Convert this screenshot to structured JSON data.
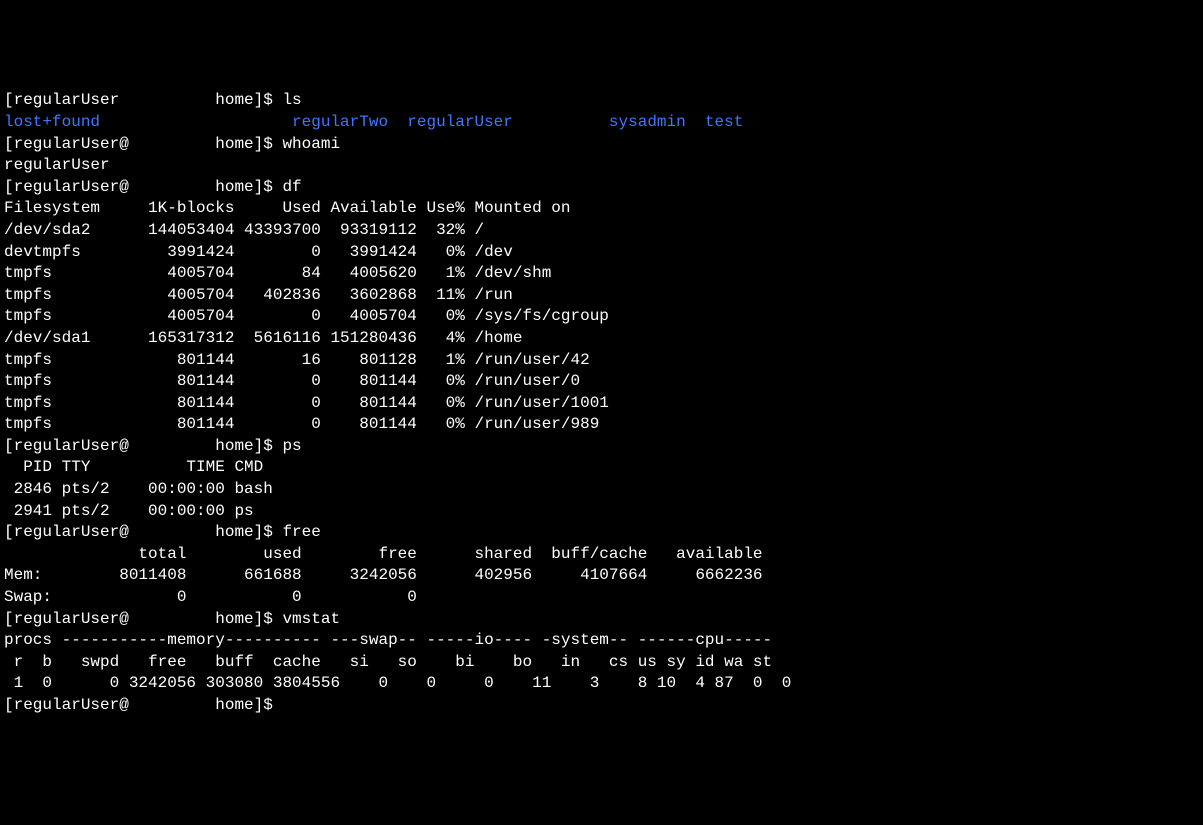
{
  "lines": [
    {
      "type": "prompt",
      "prefix": "[regularUser          home]$ ",
      "cmd": "ls"
    },
    {
      "type": "dirlist",
      "items": [
        "lost+found",
        "regularTwo",
        "regularUser",
        "sysadmin",
        "test"
      ],
      "spacing": [
        "lost+found                    ",
        "regularTwo  ",
        "regularUser          ",
        "sysadmin  ",
        "test"
      ]
    },
    {
      "type": "prompt",
      "prefix": "[regularUser@         home]$ ",
      "cmd": "whoami"
    },
    {
      "type": "output",
      "text": "regularUser"
    },
    {
      "type": "prompt",
      "prefix": "[regularUser@         home]$ ",
      "cmd": "df"
    },
    {
      "type": "output",
      "text": "Filesystem     1K-blocks     Used Available Use% Mounted on"
    },
    {
      "type": "output",
      "text": "/dev/sda2      144053404 43393700  93319112  32% /"
    },
    {
      "type": "output",
      "text": "devtmpfs         3991424        0   3991424   0% /dev"
    },
    {
      "type": "output",
      "text": "tmpfs            4005704       84   4005620   1% /dev/shm"
    },
    {
      "type": "output",
      "text": "tmpfs            4005704   402836   3602868  11% /run"
    },
    {
      "type": "output",
      "text": "tmpfs            4005704        0   4005704   0% /sys/fs/cgroup"
    },
    {
      "type": "output",
      "text": "/dev/sda1      165317312  5616116 151280436   4% /home"
    },
    {
      "type": "output",
      "text": "tmpfs             801144       16    801128   1% /run/user/42"
    },
    {
      "type": "output",
      "text": "tmpfs             801144        0    801144   0% /run/user/0"
    },
    {
      "type": "output",
      "text": "tmpfs             801144        0    801144   0% /run/user/1001"
    },
    {
      "type": "output",
      "text": "tmpfs             801144        0    801144   0% /run/user/989"
    },
    {
      "type": "prompt",
      "prefix": "[regularUser@         home]$ ",
      "cmd": "ps"
    },
    {
      "type": "output",
      "text": "  PID TTY          TIME CMD"
    },
    {
      "type": "output",
      "text": " 2846 pts/2    00:00:00 bash"
    },
    {
      "type": "output",
      "text": " 2941 pts/2    00:00:00 ps"
    },
    {
      "type": "prompt",
      "prefix": "[regularUser@         home]$ ",
      "cmd": "free"
    },
    {
      "type": "output",
      "text": "              total        used        free      shared  buff/cache   available"
    },
    {
      "type": "output",
      "text": "Mem:        8011408      661688     3242056      402956     4107664     6662236"
    },
    {
      "type": "output",
      "text": "Swap:             0           0           0"
    },
    {
      "type": "prompt",
      "prefix": "[regularUser@         home]$ ",
      "cmd": "vmstat"
    },
    {
      "type": "output",
      "text": "procs -----------memory---------- ---swap-- -----io---- -system-- ------cpu-----"
    },
    {
      "type": "output",
      "text": " r  b   swpd   free   buff  cache   si   so    bi    bo   in   cs us sy id wa st"
    },
    {
      "type": "output",
      "text": " 1  0      0 3242056 303080 3804556    0    0     0    11    3    8 10  4 87  0  0"
    },
    {
      "type": "prompt",
      "prefix": "[regularUser@         home]$ ",
      "cmd": ""
    }
  ]
}
